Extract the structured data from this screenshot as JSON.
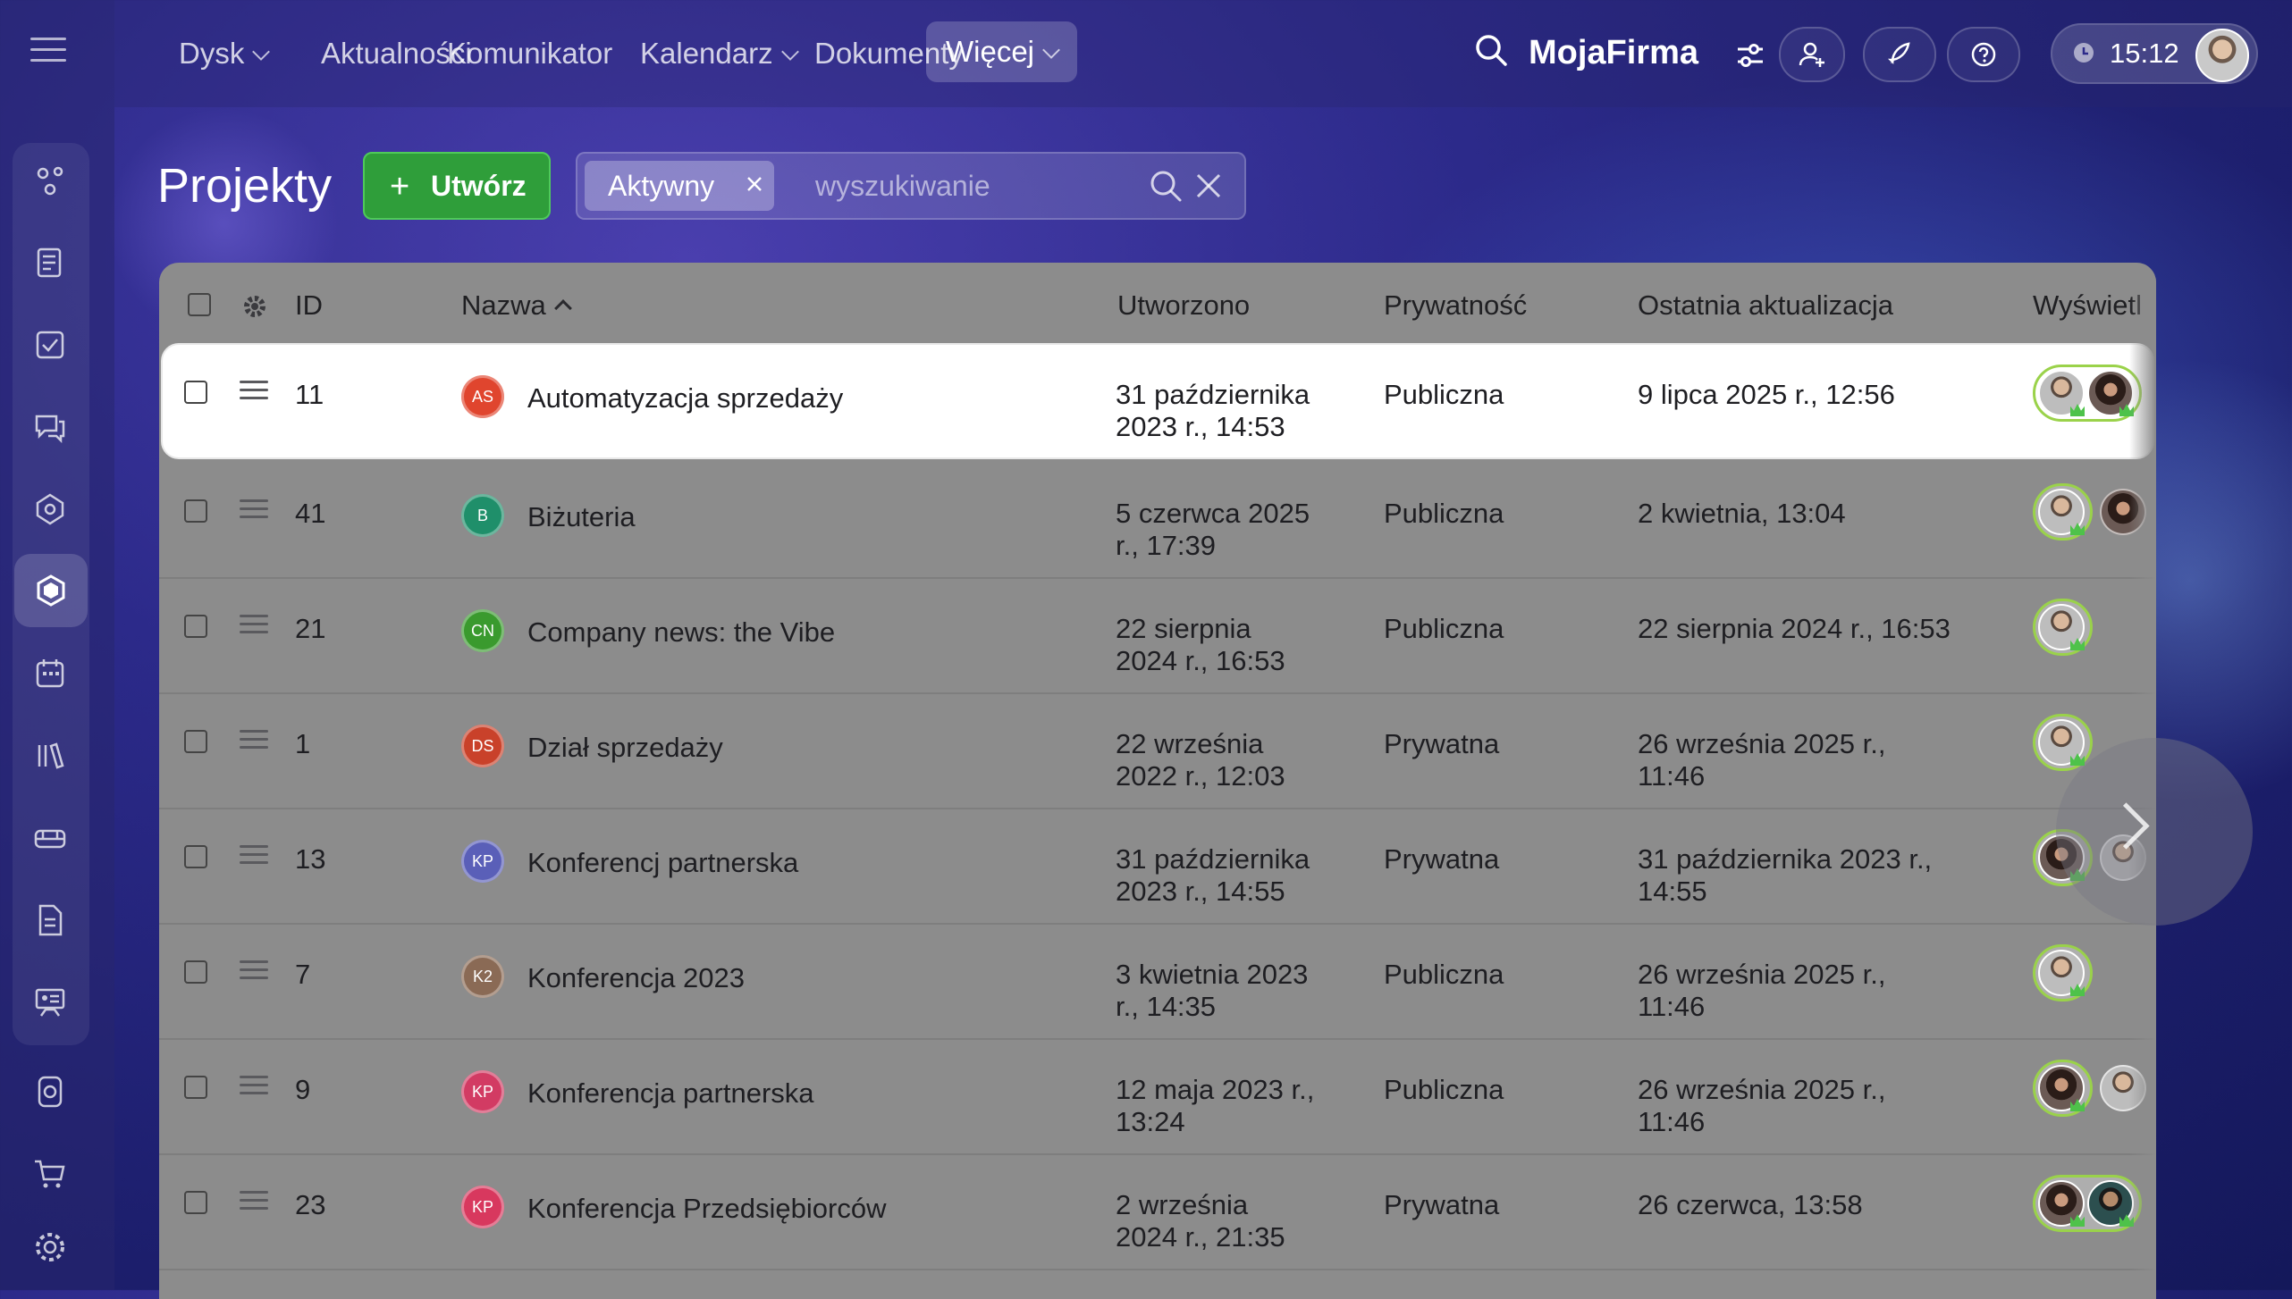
{
  "topnav": {
    "items": [
      {
        "label": "Dysk",
        "dropdown": true
      },
      {
        "label": "Aktualności",
        "dropdown": false
      },
      {
        "label": "Komunikator",
        "dropdown": false
      },
      {
        "label": "Kalendarz",
        "dropdown": true
      },
      {
        "label": "Dokumenty",
        "dropdown": false
      },
      {
        "label": "Więcej",
        "dropdown": true,
        "active": true
      }
    ],
    "brand": "MojaFirma",
    "time": "15:12"
  },
  "sidebar": {
    "icons": [
      "crm-icon",
      "feed-icon",
      "tasks-icon",
      "chat-icon",
      "sites-icon",
      "projects-icon",
      "calendar-icon",
      "knowledge-icon",
      "inventory-icon",
      "documents-icon",
      "training-icon",
      "workflow-icon",
      "cart-icon",
      "settings-icon"
    ],
    "active": "projects-icon"
  },
  "page": {
    "title": "Projekty",
    "create_label": "Utwórz",
    "filter_chip": "Aktywny",
    "search_placeholder": "wyszukiwanie"
  },
  "table": {
    "columns": {
      "id": "ID",
      "name": "Nazwa",
      "created": "Utworzono",
      "privacy": "Prywatność",
      "updated": "Ostatnia aktualizacja",
      "viewed": "Wyświetl"
    },
    "rows": [
      {
        "id": "11",
        "initials": "AS",
        "color": "#e0452e",
        "name": "Automatyzacja sprzedaży",
        "created_1": "31 października",
        "created_2": "2023 r., 14:53",
        "privacy": "Publiczna",
        "updated_1": "9 lipca 2025 r., 12:56",
        "updated_2": "",
        "members": [
          "m",
          "w"
        ],
        "extra": []
      },
      {
        "id": "41",
        "initials": "B",
        "color": "#1f8f6a",
        "name": "Biżuteria",
        "created_1": "5 czerwca 2025",
        "created_2": "r., 17:39",
        "privacy": "Publiczna",
        "updated_1": "2 kwietnia, 13:04",
        "updated_2": "",
        "members": [
          "m"
        ],
        "extra": [
          "w"
        ]
      },
      {
        "id": "21",
        "initials": "CN",
        "color": "#3a9a2e",
        "name": "Company news: the Vibe",
        "created_1": "22 sierpnia",
        "created_2": "2024 r., 16:53",
        "privacy": "Publiczna",
        "updated_1": "22 sierpnia 2024 r., 16:53",
        "updated_2": "",
        "members": [
          "m"
        ],
        "extra": []
      },
      {
        "id": "1",
        "initials": "DS",
        "color": "#c9412a",
        "name": "Dział sprzedaży",
        "created_1": "22 września",
        "created_2": "2022 r., 12:03",
        "privacy": "Prywatna",
        "updated_1": "26 września 2025 r.,",
        "updated_2": "11:46",
        "members": [
          "m"
        ],
        "extra": []
      },
      {
        "id": "13",
        "initials": "KP",
        "color": "#5a5fb8",
        "name": "Konferencj partnerska",
        "created_1": "31 października",
        "created_2": "2023 r., 14:55",
        "privacy": "Prywatna",
        "updated_1": "31 października 2023 r.,",
        "updated_2": "14:55",
        "members": [
          "w"
        ],
        "extra": [
          "m"
        ]
      },
      {
        "id": "7",
        "initials": "K2",
        "color": "#8a6a55",
        "name": "Konferencja 2023",
        "created_1": "3 kwietnia 2023",
        "created_2": "r., 14:35",
        "privacy": "Publiczna",
        "updated_1": "26 września 2025 r.,",
        "updated_2": "11:46",
        "members": [
          "m"
        ],
        "extra": []
      },
      {
        "id": "9",
        "initials": "KP",
        "color": "#d23b63",
        "name": "Konferencja partnerska",
        "created_1": "12 maja 2023 r.,",
        "created_2": "13:24",
        "privacy": "Publiczna",
        "updated_1": "26 września 2025 r.,",
        "updated_2": "11:46",
        "members": [
          "w"
        ],
        "extra": [
          "m"
        ]
      },
      {
        "id": "23",
        "initials": "KP",
        "color": "#d8385e",
        "name": "Konferencja Przedsiębiorców",
        "created_1": "2 września",
        "created_2": "2024 r., 21:35",
        "privacy": "Prywatna",
        "updated_1": "26 czerwca, 13:58",
        "updated_2": "",
        "members": [
          "w",
          "d"
        ],
        "extra": []
      }
    ]
  }
}
